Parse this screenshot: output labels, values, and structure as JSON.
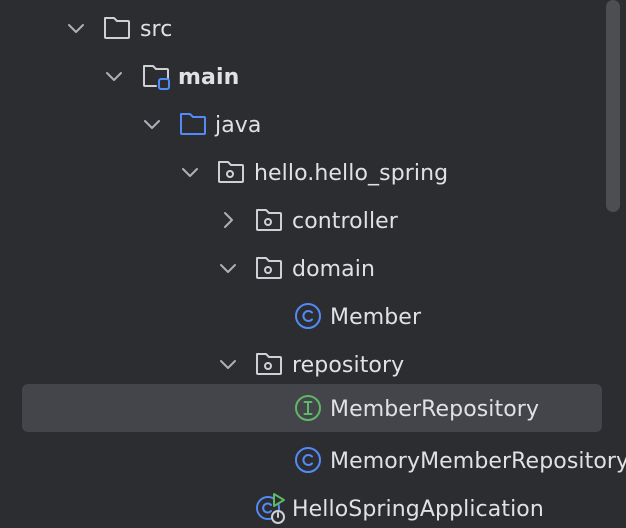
{
  "project_tree": {
    "items": [
      {
        "label": "src",
        "icon": "folder-icon",
        "expanded": true
      },
      {
        "label": "main",
        "icon": "source-root-folder-icon",
        "expanded": true
      },
      {
        "label": "java",
        "icon": "sources-folder-icon",
        "expanded": true
      },
      {
        "label": "hello.hello_spring",
        "icon": "package-icon",
        "expanded": true
      },
      {
        "label": "controller",
        "icon": "package-icon",
        "expanded": false
      },
      {
        "label": "domain",
        "icon": "package-icon",
        "expanded": true
      },
      {
        "label": "Member",
        "icon": "class-icon"
      },
      {
        "label": "repository",
        "icon": "package-icon",
        "expanded": true
      },
      {
        "label": "MemberRepository",
        "icon": "interface-icon",
        "selected": true
      },
      {
        "label": "MemoryMemberRepository",
        "icon": "class-icon"
      },
      {
        "label": "HelloSpringApplication",
        "icon": "spring-boot-application-icon"
      }
    ]
  },
  "colors": {
    "background": "#2b2d30",
    "selection": "#43454a",
    "text": "#dfe1e5",
    "folder_outline": "#ced0d6",
    "source_folder": "#548af7",
    "class_icon": "#548af7",
    "interface_icon": "#5fb865",
    "spring_icon": "#5fb865"
  }
}
